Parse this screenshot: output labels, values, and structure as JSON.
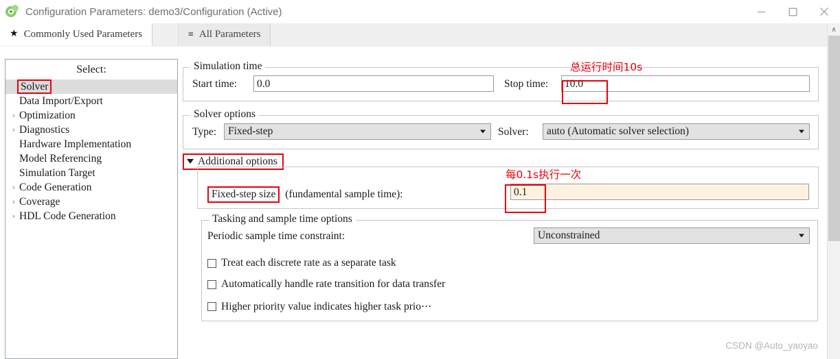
{
  "window": {
    "title": "Configuration Parameters: demo3/Configuration (Active)",
    "icon": "simulink-logo-icon",
    "minimize_label": "—",
    "maximize_label": "□",
    "close_label": "✕"
  },
  "tabs": [
    {
      "label": "Commonly Used Parameters",
      "icon": "★",
      "active": true
    },
    {
      "label": "All Parameters",
      "icon": "≡",
      "active": false
    }
  ],
  "sidebar": {
    "title": "Select:",
    "items": [
      {
        "label": "Solver",
        "arrow": "",
        "selected": true,
        "boxed": true
      },
      {
        "label": "Data Import/Export",
        "arrow": "",
        "selected": false,
        "boxed": false
      },
      {
        "label": "Optimization",
        "arrow": "›",
        "selected": false,
        "boxed": false
      },
      {
        "label": "Diagnostics",
        "arrow": "›",
        "selected": false,
        "boxed": false
      },
      {
        "label": "Hardware Implementation",
        "arrow": "",
        "selected": false,
        "boxed": false
      },
      {
        "label": "Model Referencing",
        "arrow": "",
        "selected": false,
        "boxed": false
      },
      {
        "label": "Simulation Target",
        "arrow": "",
        "selected": false,
        "boxed": false
      },
      {
        "label": "Code Generation",
        "arrow": "›",
        "selected": false,
        "boxed": false
      },
      {
        "label": "Coverage",
        "arrow": "›",
        "selected": false,
        "boxed": false
      },
      {
        "label": "HDL Code Generation",
        "arrow": "›",
        "selected": false,
        "boxed": false
      }
    ]
  },
  "simulation_time": {
    "group_title": "Simulation time",
    "start_time_label": "Start time:",
    "start_time_value": "0.0",
    "stop_time_label": "Stop time:",
    "stop_time_value": "10.0"
  },
  "solver_options": {
    "group_title": "Solver options",
    "type_label": "Type:",
    "type_value": "Fixed-step",
    "solver_label": "Solver:",
    "solver_value": "auto (Automatic solver selection)"
  },
  "additional_options": {
    "disclosure_label": "Additional options",
    "expanded": true,
    "fixed_step_label": "Fixed-step size",
    "fixed_step_suffix": "(fundamental sample time):",
    "fixed_step_value": "0.1"
  },
  "tasking": {
    "group_title": "Tasking and sample time options",
    "constraint_label": "Periodic sample time constraint:",
    "constraint_value": "Unconstrained",
    "checkboxes": [
      {
        "label": "Treat each discrete rate as a separate task",
        "checked": false
      },
      {
        "label": "Automatically handle rate transition for data transfer",
        "checked": false
      },
      {
        "label": "Higher priority value indicates higher task prio⋯",
        "checked": false
      }
    ]
  },
  "annotations": [
    {
      "text": "总运行时间10s",
      "color": "#e8000a"
    },
    {
      "text": "每0.1s执行一次",
      "color": "#e8000a"
    }
  ],
  "scrollbar": {
    "up_arrow": "∧"
  },
  "watermark": {
    "text": "CSDN @Auto_yaoyao"
  },
  "colors": {
    "annotation_red": "#e8000a",
    "selection_gray": "#dcdcdc",
    "field_cream": "#fdf2e0",
    "combo_gray": "#e2e2e2"
  }
}
